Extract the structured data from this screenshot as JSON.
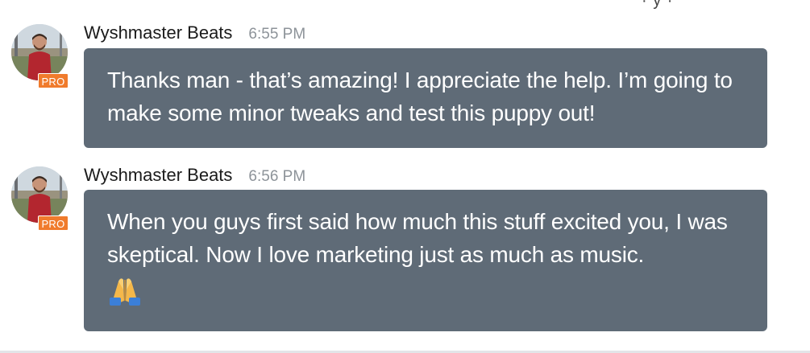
{
  "top_fragment": "· y ·",
  "messages": [
    {
      "sender": "Wyshmaster Beats",
      "time": "6:55 PM",
      "badge": "PRO",
      "text": "Thanks man - that’s amazing! I appreciate the help. I’m going to make some minor tweaks and test this puppy out!"
    },
    {
      "sender": "Wyshmaster Beats",
      "time": "6:56 PM",
      "badge": "PRO",
      "text": "When you guys first said how much this stuff excited you, I was skeptical. Now I love marketing just as much as music.",
      "emoji": "folded-hands-icon"
    }
  ],
  "colors": {
    "bubble": "#5f6b77",
    "badge": "#f07b2c",
    "timestamp": "#8d9399",
    "sender": "#1b1b1b"
  }
}
